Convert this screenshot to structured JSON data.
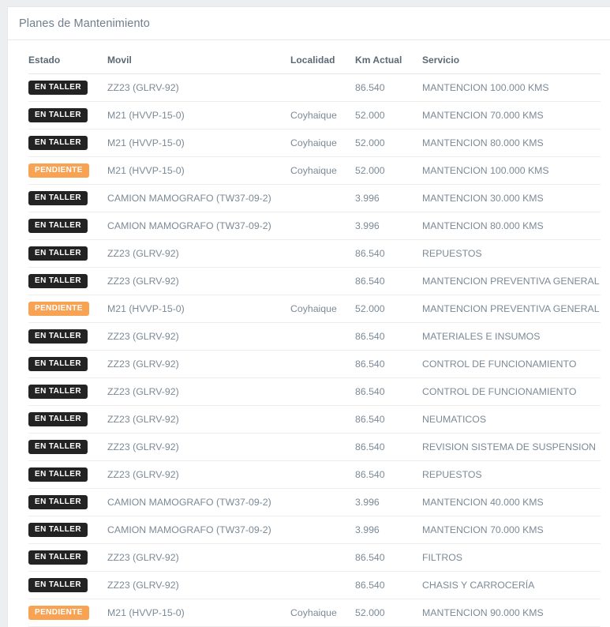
{
  "card": {
    "title": "Planes de Mantenimiento"
  },
  "colors": {
    "badge_en_taller_bg": "#232323",
    "badge_pendiente_bg": "#f8a254",
    "badge_text": "#ffffff",
    "title_text": "#6f7e8c",
    "header_text": "#5c6873",
    "body_text": "#7c8a96",
    "page_bg": "#edeef0",
    "card_bg": "#ffffff",
    "row_divider": "#ededed"
  },
  "table": {
    "columns": [
      {
        "key": "estado",
        "label": "Estado"
      },
      {
        "key": "movil",
        "label": "Movil"
      },
      {
        "key": "localidad",
        "label": "Localidad"
      },
      {
        "key": "km_actual",
        "label": "Km Actual"
      },
      {
        "key": "servicio",
        "label": "Servicio"
      }
    ],
    "rows": [
      {
        "estado": "EN TALLER",
        "estado_kind": "dark",
        "movil": "ZZ23 (GLRV-92)",
        "localidad": "",
        "km_actual": "86.540",
        "servicio": "MANTENCION 100.000 KMS"
      },
      {
        "estado": "EN TALLER",
        "estado_kind": "dark",
        "movil": "M21 (HVVP-15-0)",
        "localidad": "Coyhaique",
        "km_actual": "52.000",
        "servicio": "MANTENCION 70.000 KMS"
      },
      {
        "estado": "EN TALLER",
        "estado_kind": "dark",
        "movil": "M21 (HVVP-15-0)",
        "localidad": "Coyhaique",
        "km_actual": "52.000",
        "servicio": "MANTENCION 80.000 KMS"
      },
      {
        "estado": "PENDIENTE",
        "estado_kind": "warn",
        "movil": "M21 (HVVP-15-0)",
        "localidad": "Coyhaique",
        "km_actual": "52.000",
        "servicio": "MANTENCION 100.000 KMS"
      },
      {
        "estado": "EN TALLER",
        "estado_kind": "dark",
        "movil": "CAMION MAMOGRAFO (TW37-09-2)",
        "localidad": "",
        "km_actual": "3.996",
        "servicio": "MANTENCION 30.000 KMS"
      },
      {
        "estado": "EN TALLER",
        "estado_kind": "dark",
        "movil": "CAMION MAMOGRAFO (TW37-09-2)",
        "localidad": "",
        "km_actual": "3.996",
        "servicio": "MANTENCION 80.000 KMS"
      },
      {
        "estado": "EN TALLER",
        "estado_kind": "dark",
        "movil": "ZZ23 (GLRV-92)",
        "localidad": "",
        "km_actual": "86.540",
        "servicio": "REPUESTOS"
      },
      {
        "estado": "EN TALLER",
        "estado_kind": "dark",
        "movil": "ZZ23 (GLRV-92)",
        "localidad": "",
        "km_actual": "86.540",
        "servicio": "MANTENCION PREVENTIVA GENERAL"
      },
      {
        "estado": "PENDIENTE",
        "estado_kind": "warn",
        "movil": "M21 (HVVP-15-0)",
        "localidad": "Coyhaique",
        "km_actual": "52.000",
        "servicio": "MANTENCION PREVENTIVA GENERAL"
      },
      {
        "estado": "EN TALLER",
        "estado_kind": "dark",
        "movil": "ZZ23 (GLRV-92)",
        "localidad": "",
        "km_actual": "86.540",
        "servicio": "MATERIALES E INSUMOS"
      },
      {
        "estado": "EN TALLER",
        "estado_kind": "dark",
        "movil": "ZZ23 (GLRV-92)",
        "localidad": "",
        "km_actual": "86.540",
        "servicio": "CONTROL DE FUNCIONAMIENTO"
      },
      {
        "estado": "EN TALLER",
        "estado_kind": "dark",
        "movil": "ZZ23 (GLRV-92)",
        "localidad": "",
        "km_actual": "86.540",
        "servicio": "CONTROL DE FUNCIONAMIENTO"
      },
      {
        "estado": "EN TALLER",
        "estado_kind": "dark",
        "movil": "ZZ23 (GLRV-92)",
        "localidad": "",
        "km_actual": "86.540",
        "servicio": "NEUMATICOS"
      },
      {
        "estado": "EN TALLER",
        "estado_kind": "dark",
        "movil": "ZZ23 (GLRV-92)",
        "localidad": "",
        "km_actual": "86.540",
        "servicio": "REVISION SISTEMA DE SUSPENSION"
      },
      {
        "estado": "EN TALLER",
        "estado_kind": "dark",
        "movil": "ZZ23 (GLRV-92)",
        "localidad": "",
        "km_actual": "86.540",
        "servicio": "REPUESTOS"
      },
      {
        "estado": "EN TALLER",
        "estado_kind": "dark",
        "movil": "CAMION MAMOGRAFO (TW37-09-2)",
        "localidad": "",
        "km_actual": "3.996",
        "servicio": "MANTENCION 40.000 KMS"
      },
      {
        "estado": "EN TALLER",
        "estado_kind": "dark",
        "movil": "CAMION MAMOGRAFO (TW37-09-2)",
        "localidad": "",
        "km_actual": "3.996",
        "servicio": "MANTENCION 70.000 KMS"
      },
      {
        "estado": "EN TALLER",
        "estado_kind": "dark",
        "movil": "ZZ23 (GLRV-92)",
        "localidad": "",
        "km_actual": "86.540",
        "servicio": "FILTROS"
      },
      {
        "estado": "EN TALLER",
        "estado_kind": "dark",
        "movil": "ZZ23 (GLRV-92)",
        "localidad": "",
        "km_actual": "86.540",
        "servicio": "CHASIS Y CARROCERÍA"
      },
      {
        "estado": "PENDIENTE",
        "estado_kind": "warn",
        "movil": "M21 (HVVP-15-0)",
        "localidad": "Coyhaique",
        "km_actual": "52.000",
        "servicio": "MANTENCION 90.000 KMS"
      }
    ]
  }
}
